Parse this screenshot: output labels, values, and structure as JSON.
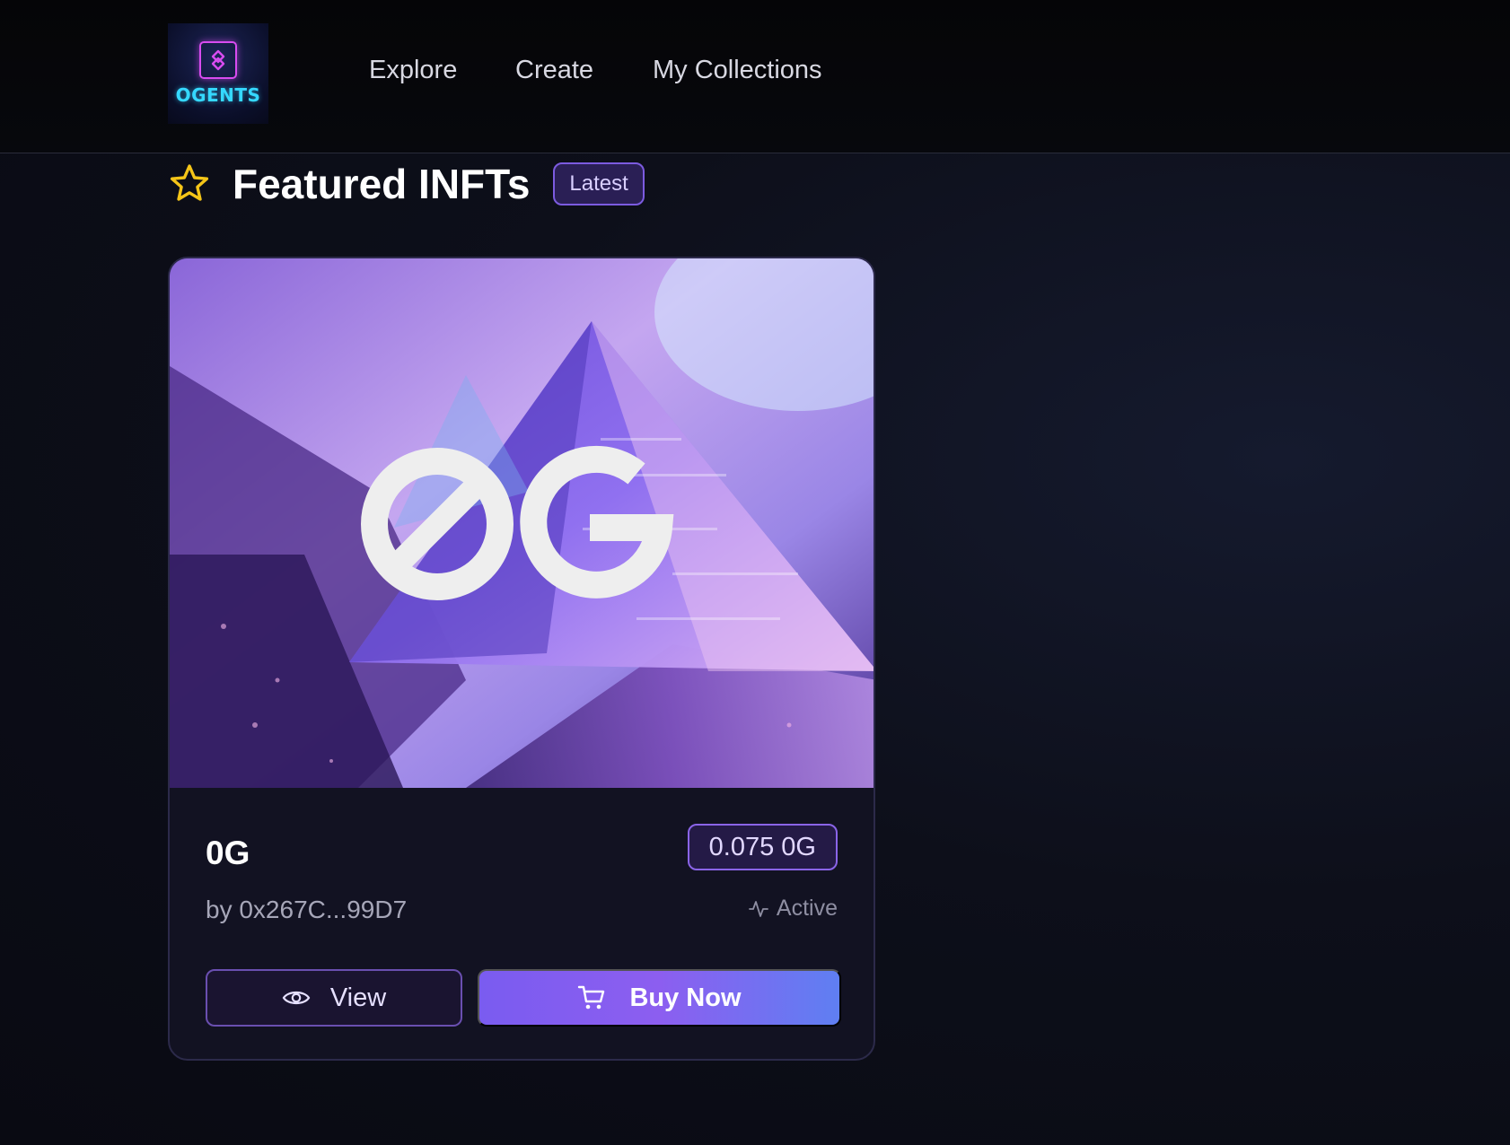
{
  "header": {
    "logo_text": "OGENTS",
    "nav": [
      {
        "label": "Explore"
      },
      {
        "label": "Create"
      },
      {
        "label": "My Collections"
      }
    ]
  },
  "featured": {
    "title": "Featured INFTs",
    "badge": "Latest",
    "icon": "star-icon",
    "accent_color": "#f5c518"
  },
  "card": {
    "image_text": "0G",
    "name": "0G",
    "price": "0.075 0G",
    "creator": "by 0x267C...99D7",
    "status": "Active",
    "view_label": "View",
    "buy_label": "Buy Now",
    "buy_gradient": [
      "#7a5cf0",
      "#5f7ff2"
    ]
  }
}
